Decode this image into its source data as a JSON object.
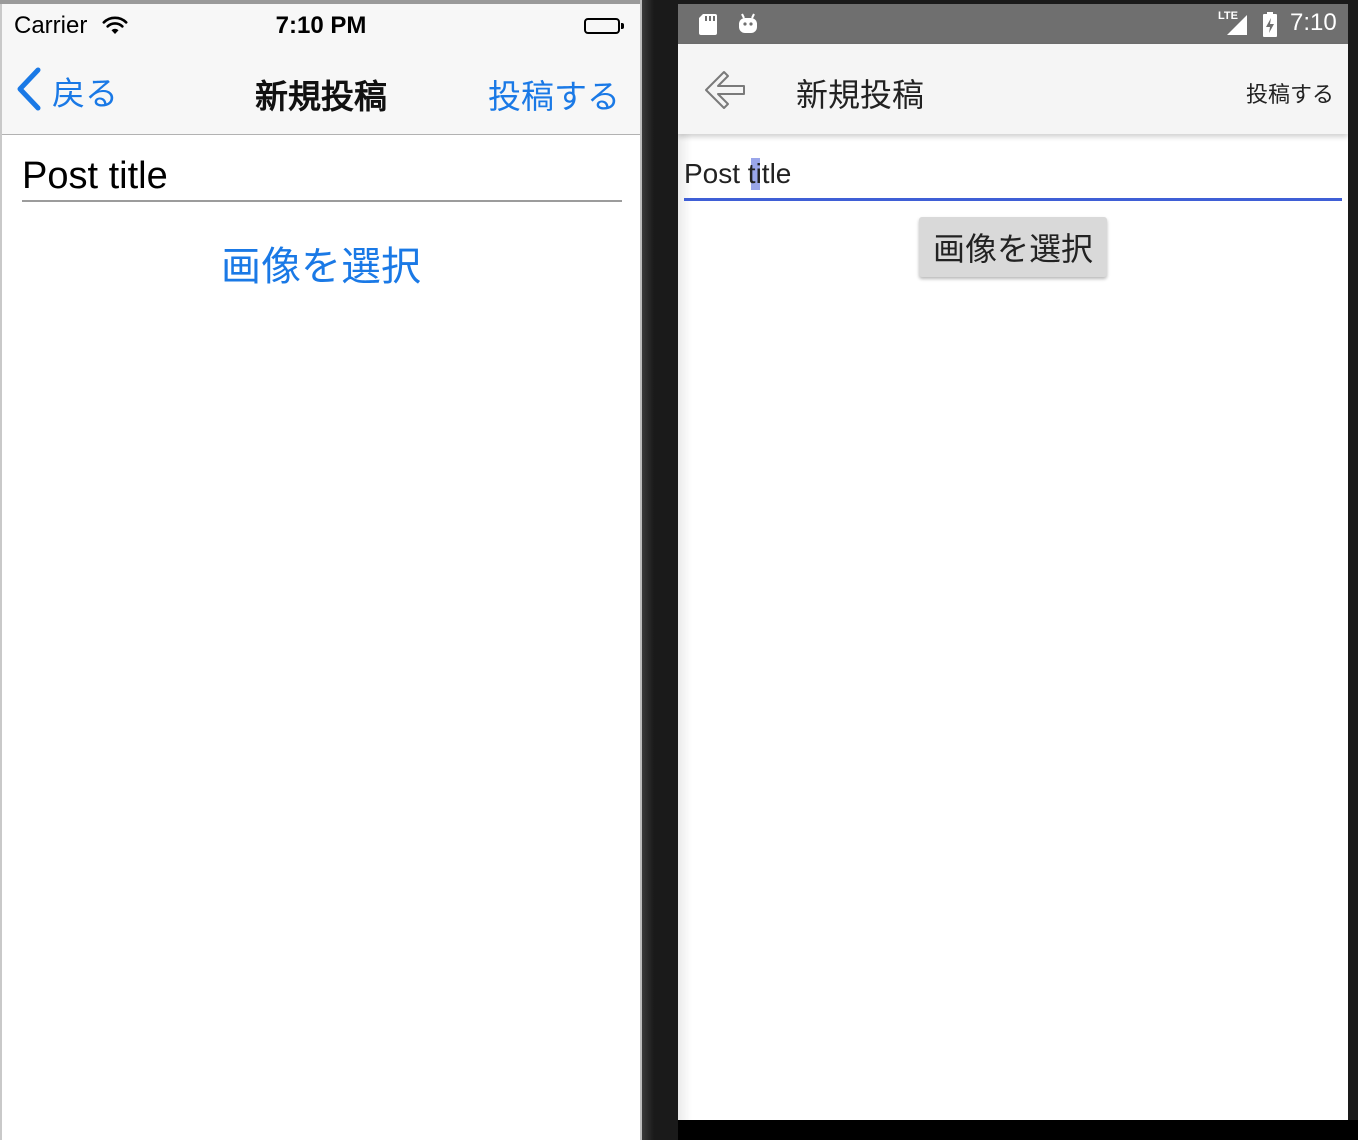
{
  "ios": {
    "status_bar": {
      "carrier": "Carrier",
      "time": "7:10 PM",
      "wifi_icon": "wifi-icon",
      "battery_icon": "battery-full-icon"
    },
    "nav_bar": {
      "back_label": "戻る",
      "title": "新規投稿",
      "post_label": "投稿する"
    },
    "form": {
      "title_placeholder": "Post title",
      "select_image_label": "画像を選択"
    },
    "accent_color": "#1a79e6"
  },
  "android": {
    "status_bar": {
      "sd_icon": "sd-card-icon",
      "debug_icon": "android-debug-icon",
      "network_label": "LTE",
      "signal_icon": "signal-icon",
      "battery_icon": "battery-charging-icon",
      "time": "7:10"
    },
    "app_bar": {
      "back_icon": "arrow-back-icon",
      "title": "新規投稿",
      "post_label": "投稿する"
    },
    "form": {
      "title_placeholder": "Post title",
      "select_image_label": "画像を選択"
    },
    "accent_color": "#3f5fd6"
  }
}
